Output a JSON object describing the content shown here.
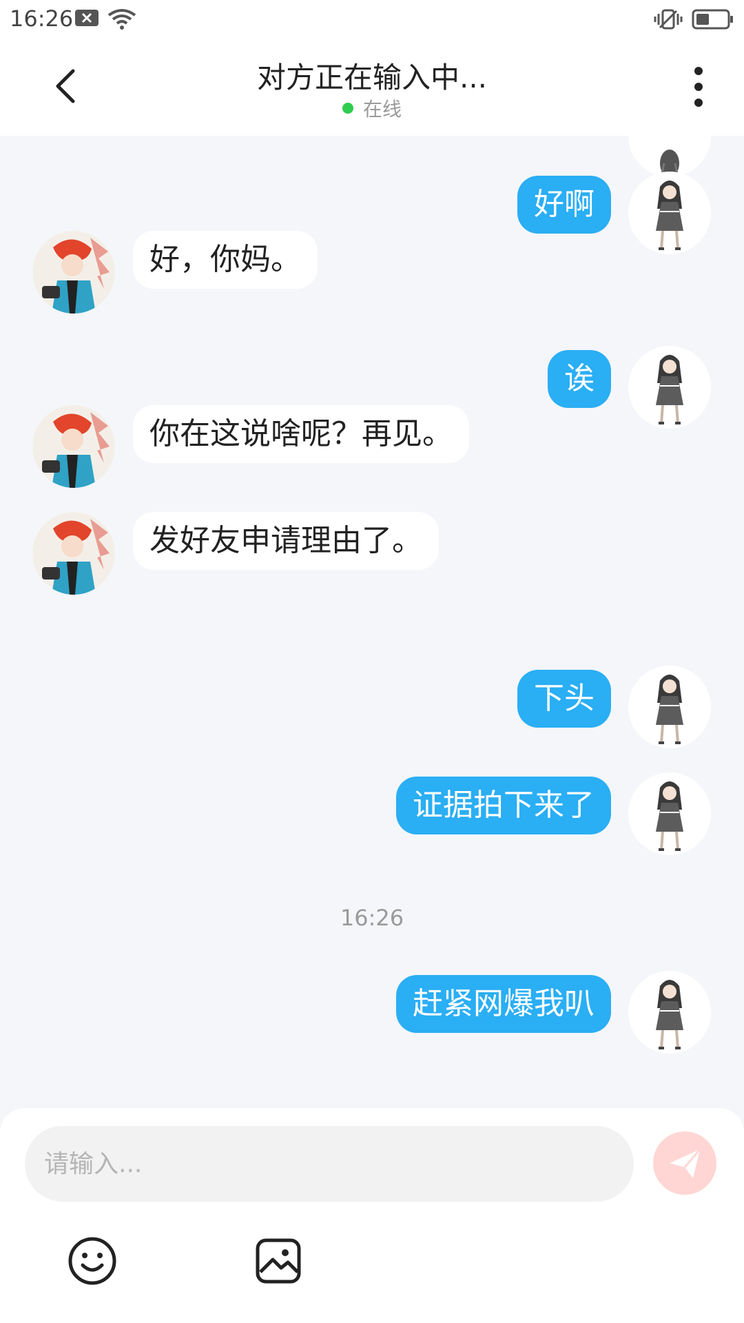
{
  "status_bar": {
    "time": "16:26"
  },
  "header": {
    "title": "对方正在输入中...",
    "status": "在线"
  },
  "messages": [
    {
      "side": "right",
      "text": "好啊"
    },
    {
      "side": "left",
      "text": "好，你妈。"
    },
    {
      "side": "right",
      "text": "诶"
    },
    {
      "side": "left",
      "text": "你在这说啥呢？再见。"
    },
    {
      "side": "left",
      "text": "发好友申请理由了。"
    },
    {
      "side": "right",
      "text": "下头"
    },
    {
      "side": "right",
      "text": "证据拍下来了"
    },
    {
      "side": "right",
      "text": "赶紧网爆我叭"
    }
  ],
  "timestamp": "16:26",
  "input": {
    "placeholder": "请输入..."
  },
  "colors": {
    "sent_bubble": "#2aaef4",
    "received_bubble": "#ffffff",
    "online_dot": "#2ecc4f",
    "send_button": "#ffd6d3",
    "background": "#f4f6f9"
  },
  "icons": {
    "back": "chevron-left-icon",
    "more": "more-vertical-icon",
    "send": "paper-plane-icon",
    "emoji": "smiley-icon",
    "image": "image-icon"
  }
}
